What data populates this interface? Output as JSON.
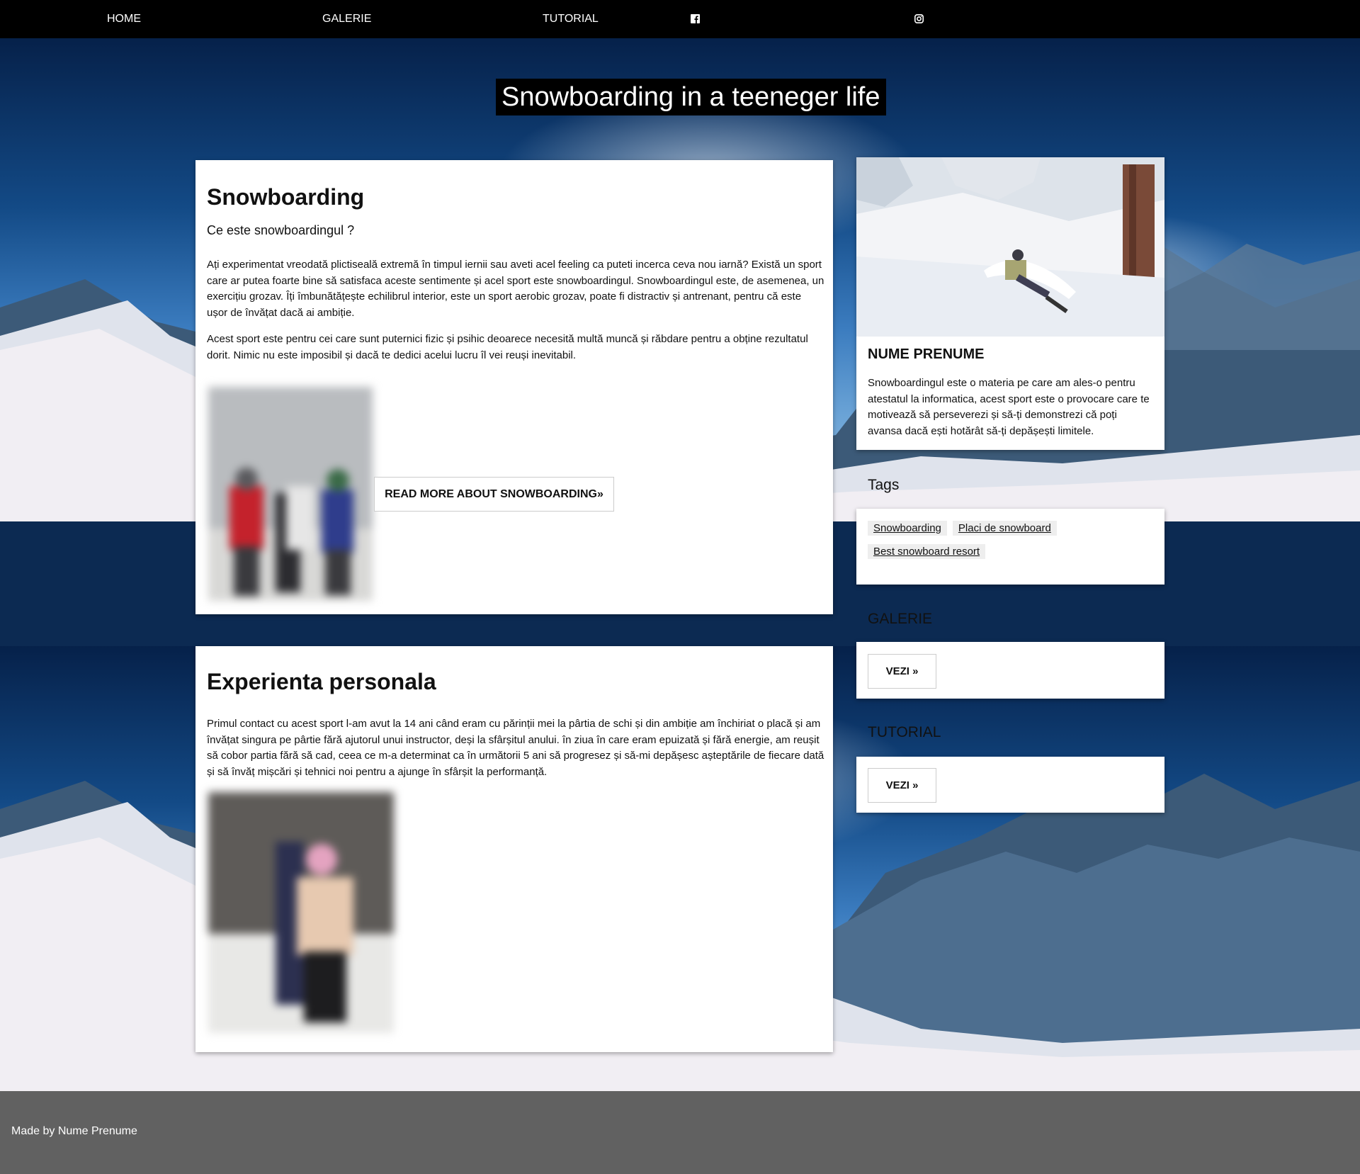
{
  "nav": {
    "home": "HOME",
    "galerie": "GALERIE",
    "tutorial": "TUTORIAL",
    "facebook_icon": "facebook-icon",
    "instagram_icon": "instagram-icon"
  },
  "header": {
    "title": "Snowboarding in a teeneger life"
  },
  "article1": {
    "title": "Snowboarding",
    "subtitle": "Ce este snowboardingul ?",
    "p1": "Ați experimentat vreodată plictiseală extremă în timpul iernii sau aveti acel feeling ca puteti incerca ceva nou iarnă? Există un sport care ar putea foarte bine să satisfaca aceste sentimente și acel sport este snowboardingul. Snowboardingul este, de asemenea, un exercițiu grozav. Îți îmbunătățește echilibrul interior, este un sport aerobic grozav, poate fi distractiv și antrenant, pentru că este ușor de învățat dacă ai ambiție.",
    "p2": "Acest sport este pentru cei care sunt puternici fizic și psihic deoarece necesită multă muncă și răbdare pentru a obține rezultatul dorit. Nimic nu este imposibil și dacă te dedici acelui lucru îl vei reuși inevitabil.",
    "read_more": "READ MORE ABOUT SNOWBOARDING»"
  },
  "article2": {
    "title": "Experienta personala",
    "p1": "Primul contact cu acest sport l-am avut la 14 ani când eram cu părinții mei la pârtia de schi și din ambiție am închiriat o placă și am învățat singura pe pârtie fără ajutorul unui instructor, deși la sfârșitul anului. în ziua în care eram epuizată și fără energie, am reușit să cobor partia fără să cad, ceea ce m-a determinat ca în următorii 5 ani să progresez și să-mi depășesc așteptările de fiecare dată și să învăț mișcări și tehnici noi pentru a ajunge în sfârșit la performanță."
  },
  "profile": {
    "name": "NUME PRENUME",
    "bio": "Snowboardingul este o materia pe care am ales-o pentru atestatul la informatica, acest sport este o provocare care te motivează să perseverezi și să-ți demonstrezi că poți avansa dacă ești hotărât să-ți depășești limitele."
  },
  "tags": {
    "title": "Tags",
    "items": [
      "Snowboarding",
      "Placi de snowboard",
      "Best snowboard resort"
    ]
  },
  "galerie": {
    "title": "GALERIE",
    "button": "VEZI »"
  },
  "tutorial": {
    "title": "TUTORIAL",
    "button": "VEZI »"
  },
  "footer": {
    "text": "Made by Nume Prenume"
  }
}
